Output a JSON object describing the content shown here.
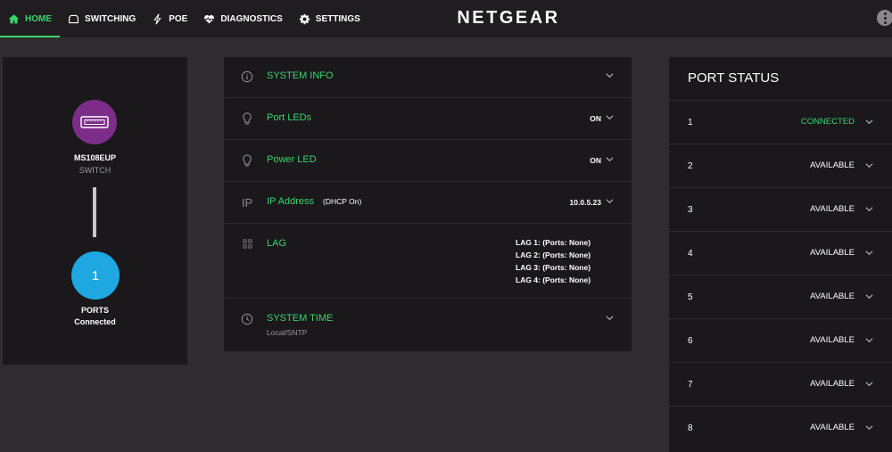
{
  "nav": {
    "items": [
      {
        "label": "HOME",
        "icon": "home-icon"
      },
      {
        "label": "SWITCHING",
        "icon": "switch-icon"
      },
      {
        "label": "POE",
        "icon": "bolt-icon"
      },
      {
        "label": "DIAGNOSTICS",
        "icon": "heart-pulse-icon"
      },
      {
        "label": "SETTINGS",
        "icon": "gear-icon"
      }
    ],
    "active": "HOME",
    "accent": "#3ad46a"
  },
  "brand": "NETGEAR",
  "device": {
    "model": "MS108EUP",
    "type": "SWITCH",
    "ports_count": "1",
    "ports_label": "PORTS",
    "ports_status": "Connected",
    "device_color": "#7c2d8a",
    "ports_color": "#1ea7e0"
  },
  "info": {
    "system_info": {
      "label": "SYSTEM INFO",
      "icon": "info-icon"
    },
    "port_leds": {
      "label": "Port LEDs",
      "value": "ON",
      "icon": "bulb-icon"
    },
    "power_led": {
      "label": "Power LED",
      "value": "ON",
      "icon": "bulb-icon"
    },
    "ip_address": {
      "label": "IP Address",
      "extra": "(DHCP On)",
      "value": "10.0.5.23",
      "icon_text": "IP"
    },
    "lag": {
      "label": "LAG",
      "icon": "lag-icon",
      "entries": [
        "LAG 1: (Ports: None)",
        "LAG 2: (Ports: None)",
        "LAG 3: (Ports: None)",
        "LAG 4: (Ports: None)"
      ]
    },
    "system_time": {
      "label": "SYSTEM TIME",
      "sub": "Local/SNTP",
      "icon": "clock-icon"
    }
  },
  "port_status": {
    "title": "PORT STATUS",
    "ports": [
      {
        "num": "1",
        "state": "CONNECTED"
      },
      {
        "num": "2",
        "state": "AVAILABLE"
      },
      {
        "num": "3",
        "state": "AVAILABLE"
      },
      {
        "num": "4",
        "state": "AVAILABLE"
      },
      {
        "num": "5",
        "state": "AVAILABLE"
      },
      {
        "num": "6",
        "state": "AVAILABLE"
      },
      {
        "num": "7",
        "state": "AVAILABLE"
      },
      {
        "num": "8",
        "state": "AVAILABLE"
      }
    ]
  }
}
